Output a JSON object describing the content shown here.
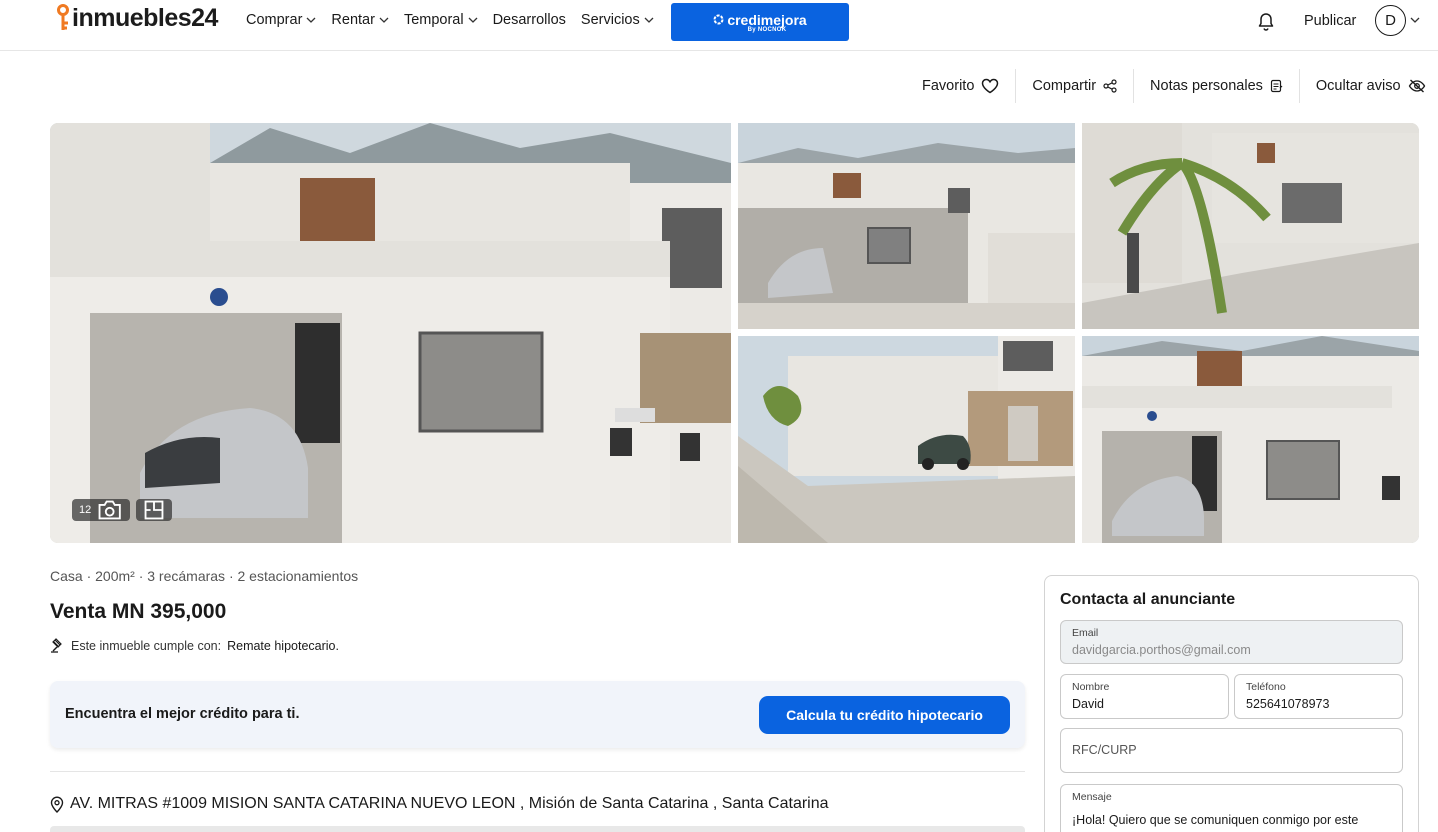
{
  "header": {
    "logo_text": "inmuebles24",
    "nav": [
      {
        "label": "Comprar",
        "has_dropdown": true
      },
      {
        "label": "Rentar",
        "has_dropdown": true
      },
      {
        "label": "Temporal",
        "has_dropdown": true
      },
      {
        "label": "Desarrollos",
        "has_dropdown": false
      },
      {
        "label": "Servicios",
        "has_dropdown": true
      }
    ],
    "banner": {
      "title": "credimejora",
      "subtitle": "By NOCNOK",
      "color": "#0a63e0"
    },
    "publish_label": "Publicar",
    "avatar_initial": "D",
    "icons": {
      "notifications": "bell-icon",
      "avatar_menu": "chevron-down-icon"
    }
  },
  "actions": [
    {
      "label": "Favorito",
      "icon": "heart-icon"
    },
    {
      "label": "Compartir",
      "icon": "share-icon"
    },
    {
      "label": "Notas personales",
      "icon": "notes-icon"
    },
    {
      "label": "Ocultar aviso",
      "icon": "eye-off-icon"
    }
  ],
  "gallery": {
    "photo_count": "12",
    "icons": {
      "photos": "camera-icon",
      "floorplan": "floorplan-icon"
    }
  },
  "listing": {
    "features": "Casa · 200m² · 3 recámaras · 2 estacionamientos",
    "price": "Venta MN 395,000",
    "compliance_prefix": "Este inmueble cumple con:",
    "compliance_value": "Remate hipotecario.",
    "credit_text": "Encuentra el mejor crédito para ti.",
    "credit_button": "Calcula tu crédito hipotecario",
    "address": "AV. MITRAS #1009 MISION SANTA CATARINA NUEVO LEON , Misión de Santa Catarina , Santa Catarina"
  },
  "contact": {
    "title": "Contacta al anunciante",
    "email_label": "Email",
    "email_value": "davidgarcia.porthos@gmail.com",
    "name_label": "Nombre",
    "name_value": "David",
    "phone_label": "Teléfono",
    "phone_value": "525641078973",
    "rfc_placeholder": "RFC/CURP",
    "message_label": "Mensaje",
    "message_value": "¡Hola! Quiero que se comuniquen conmigo por este"
  },
  "colors": {
    "accent": "#0a63e0",
    "logo_orange": "#f07a22"
  }
}
